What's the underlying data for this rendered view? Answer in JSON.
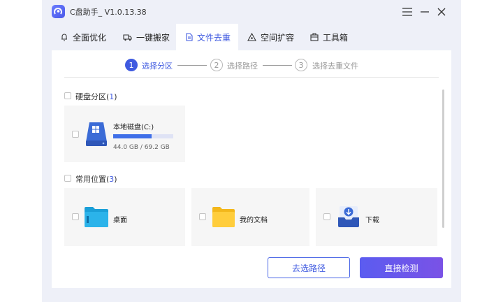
{
  "app": {
    "title": "C盘助手_ V1.0.13.38"
  },
  "tabs": [
    {
      "label": "全面优化",
      "icon": "bell-icon"
    },
    {
      "label": "一键搬家",
      "icon": "truck-icon"
    },
    {
      "label": "文件去重",
      "icon": "file-icon"
    },
    {
      "label": "空间扩容",
      "icon": "expand-icon"
    },
    {
      "label": "工具箱",
      "icon": "toolbox-icon"
    }
  ],
  "steps": [
    {
      "num": "1",
      "label": "选择分区"
    },
    {
      "num": "2",
      "label": "选择路径"
    },
    {
      "num": "3",
      "label": "选择去重文件"
    }
  ],
  "disk_section": {
    "title": "硬盘分区(",
    "count": "1",
    "suffix": ")",
    "disk": {
      "name": "本地磁盘(C:)",
      "size": "44.0 GB / 69.2 GB",
      "usage_fraction": 0.636
    }
  },
  "common_section": {
    "title": "常用位置(",
    "count": "3",
    "suffix": ")",
    "items": [
      {
        "label": "桌面",
        "icon": "desktop-folder-icon"
      },
      {
        "label": "我的文档",
        "icon": "documents-folder-icon"
      },
      {
        "label": "下载",
        "icon": "download-icon"
      }
    ]
  },
  "buttons": {
    "choose_path": "去选路径",
    "detect": "直接检测"
  },
  "colors": {
    "accent": "#3f5ae0",
    "progress": "#3f6fe8"
  }
}
